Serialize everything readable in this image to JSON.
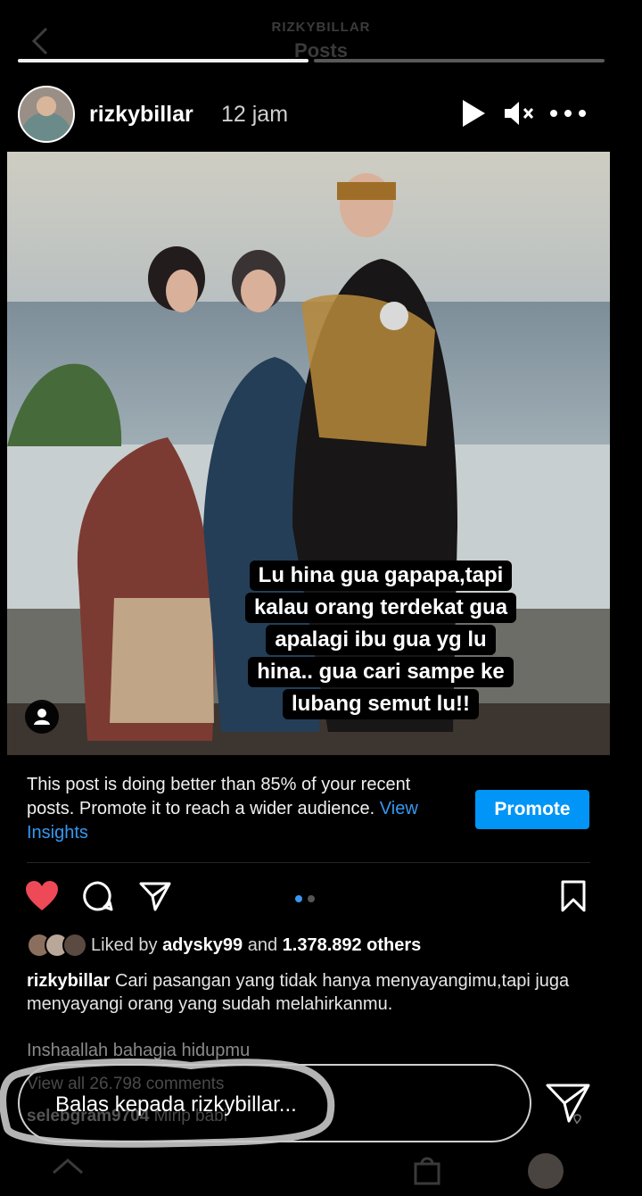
{
  "ghost_header": {
    "username": "RIZKYBILLAR",
    "title": "Posts"
  },
  "story": {
    "username": "rizkybillar",
    "time": "12 jam",
    "progress_segments": 2,
    "progress_done": 1,
    "sticker_lines": [
      "Lu hina gua gapapa,tapi",
      "kalau orang terdekat gua",
      "apalagi ibu gua yg lu",
      "hina.. gua cari sampe ke",
      "lubang semut lu!!"
    ]
  },
  "insights": {
    "text": "This post is doing better than 85% of your recent posts. Promote it to reach a wider audience.",
    "link": "View Insights",
    "promote_label": "Promote"
  },
  "likes": {
    "prefix": "Liked by",
    "user": "adysky99",
    "connector": "and",
    "count": "1.378.892 others"
  },
  "caption": {
    "username": "rizkybillar",
    "text": "Cari pasangan yang tidak hanya menyayangimu,tapi juga menyayangi orang yang sudah melahirkanmu.",
    "more": "Inshaallah bahagia hidupmu"
  },
  "comments": {
    "view_all": "View all 26.798 comments",
    "first_user": "selebgram9704",
    "first_text": "Mirip babi"
  },
  "reply": {
    "placeholder": "Balas kepada rizkybillar..."
  },
  "colors": {
    "like_red": "#ed4956",
    "promote_blue": "#0095f6",
    "link_blue": "#3897f0",
    "highlight": "#c8c8c8"
  }
}
